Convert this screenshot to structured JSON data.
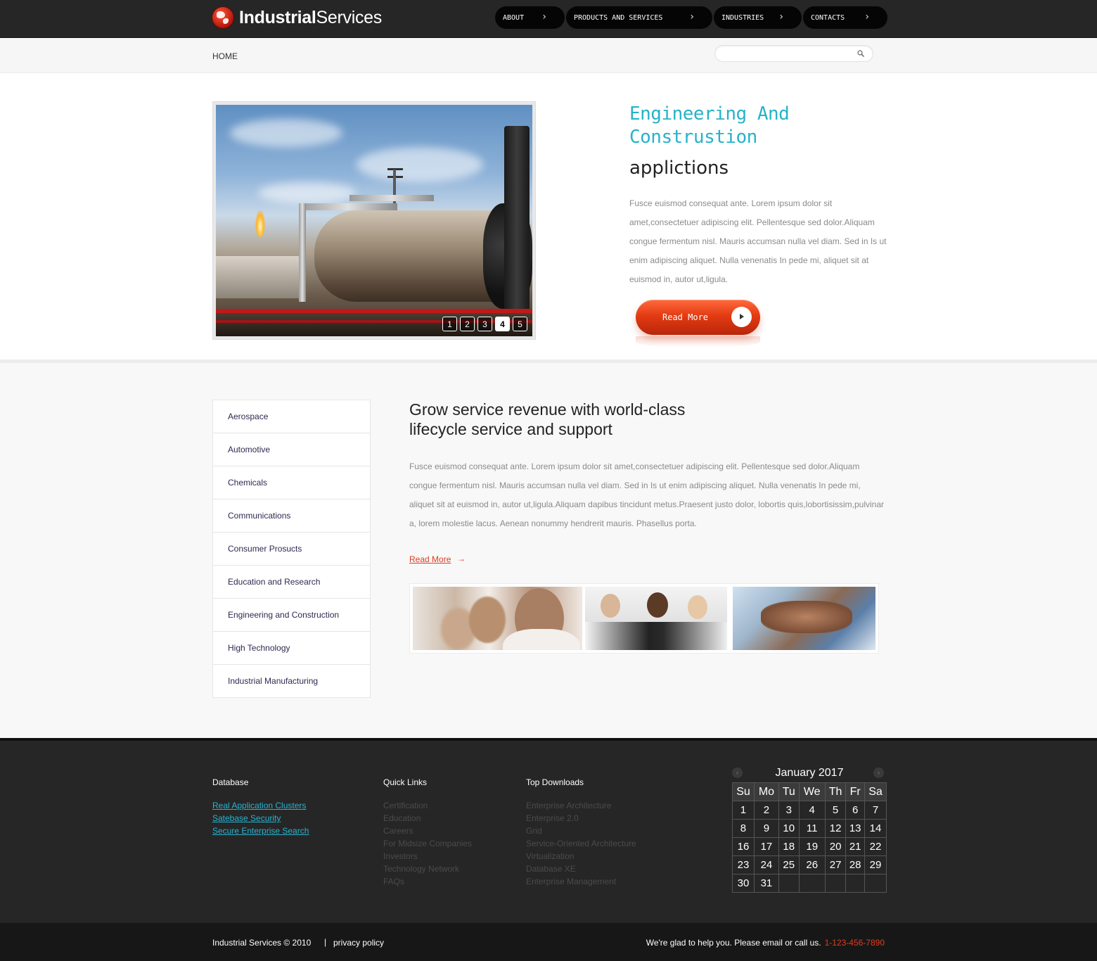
{
  "header": {
    "logo_bold": "Industrial",
    "logo_light": "Services",
    "nav": [
      {
        "label": "ABOUT"
      },
      {
        "label": "PRODUCTS AND SERVICES"
      },
      {
        "label": "INDUSTRIES"
      },
      {
        "label": "CONTACTS"
      }
    ]
  },
  "breadcrumb": {
    "home": "HOME"
  },
  "search": {
    "placeholder": ""
  },
  "hero": {
    "slides": [
      "1",
      "2",
      "3",
      "4",
      "5"
    ],
    "active_slide": "4",
    "title": "Engineering And Construstion",
    "subtitle": "applictions",
    "text": "Fusce euismod consequat ante. Lorem ipsum dolor sit amet,consectetuer adipiscing elit. Pellentesque sed dolor.Aliquam congue fermentum nisl. Mauris accumsan nulla vel diam. Sed in Is ut enim adipiscing aliquet. Nulla venenatis In pede mi, aliquet sit at euismod in, autor ut,ligula.",
    "read_more": "Read More"
  },
  "sidebar": {
    "items": [
      {
        "label": "Aerospace"
      },
      {
        "label": "Automotive"
      },
      {
        "label": "Chemicals"
      },
      {
        "label": "Communications"
      },
      {
        "label": "Consumer Prosucts"
      },
      {
        "label": "Education and Research"
      },
      {
        "label": "Engineering and Construction"
      },
      {
        "label": "High Technology"
      },
      {
        "label": "Industrial Manufacturing"
      }
    ]
  },
  "main": {
    "title": "Grow service revenue with world-class lifecycle service and support",
    "text": "Fusce euismod consequat ante. Lorem ipsum dolor sit amet,consectetuer adipiscing elit. Pellentesque sed dolor.Aliquam congue fermentum nisl. Mauris accumsan nulla vel diam. Sed in Is ut enim adipiscing aliquet. Nulla venenatis In pede mi, aliquet sit at euismod in, autor ut,ligula.Aliquam dapibus tincidunt metus.Praesent justo dolor, lobortis quis,lobortisissim,pulvinar a, lorem molestie lacus. Aenean nonummy hendrerit mauris. Phasellus porta.",
    "read_more": "Read More"
  },
  "footer": {
    "database": {
      "title": "Database",
      "links": [
        "Real Application Clusters",
        "Satebase Security",
        "Secure Enterprise Search"
      ]
    },
    "quick_links": {
      "title": "Quick Links",
      "links": [
        "Certification",
        "Education",
        "Careers",
        "For Midsize Companies",
        "Investors",
        "Technology Network",
        "FAQs"
      ]
    },
    "top_downloads": {
      "title": "Top Downloads",
      "links": [
        "Enterprise Architecture",
        "Enterprise 2.0",
        "Grid",
        "Service-Oriented Architecture",
        "Virtualization",
        "Database XE",
        "Enterprise Management"
      ]
    },
    "calendar": {
      "month": "January 2017",
      "days": [
        "Su",
        "Mo",
        "Tu",
        "We",
        "Th",
        "Fr",
        "Sa"
      ],
      "weeks": [
        [
          "1",
          "2",
          "3",
          "4",
          "5",
          "6",
          "7"
        ],
        [
          "8",
          "9",
          "10",
          "11",
          "12",
          "13",
          "14"
        ],
        [
          "16",
          "17",
          "18",
          "19",
          "20",
          "21",
          "22"
        ],
        [
          "23",
          "24",
          "25",
          "26",
          "27",
          "28",
          "29"
        ],
        [
          "30",
          "31",
          "",
          "",
          "",
          "",
          ""
        ]
      ]
    }
  },
  "bottom": {
    "copyright": "Industrial Services © 2010",
    "separator": "|",
    "privacy": "privacy policy",
    "help": "We're glad to help you. Please email or call us.",
    "phone": "1-123-456-7890"
  },
  "colors": {
    "accent_cyan": "#26b3c8",
    "accent_red": "#e03c1e",
    "header_bg": "#262626"
  }
}
